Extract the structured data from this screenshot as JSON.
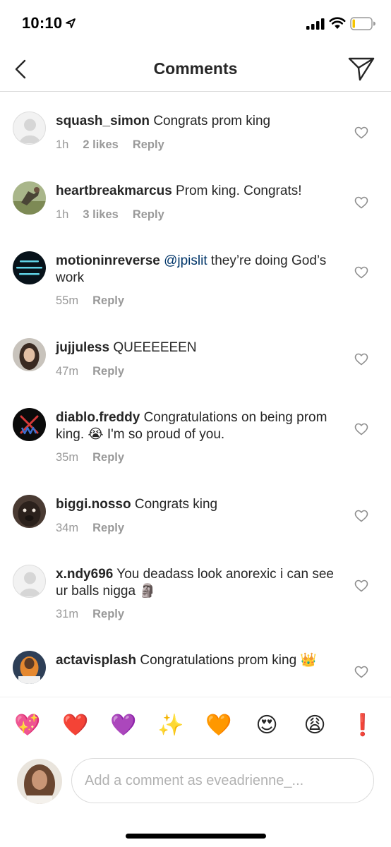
{
  "status_bar": {
    "time": "10:10"
  },
  "header": {
    "title": "Comments"
  },
  "comments": [
    {
      "username": "squash_simon",
      "mention": "",
      "text": "Congrats prom king",
      "time": "1h",
      "likes": "2 likes",
      "reply": "Reply"
    },
    {
      "username": "heartbreakmarcus",
      "mention": "",
      "text": "Prom king. Congrats!",
      "time": "1h",
      "likes": "3 likes",
      "reply": "Reply"
    },
    {
      "username": "motioninreverse",
      "mention": "@jpislit",
      "text": "they’re doing God’s work",
      "time": "55m",
      "likes": "",
      "reply": "Reply"
    },
    {
      "username": "jujjuless",
      "mention": "",
      "text": "QUEEEEEEN",
      "time": "47m",
      "likes": "",
      "reply": "Reply"
    },
    {
      "username": "diablo.freddy",
      "mention": "",
      "text": "Congratulations on being prom king. 😭 I'm so proud of you.",
      "time": "35m",
      "likes": "",
      "reply": "Reply"
    },
    {
      "username": "biggi.nosso",
      "mention": "",
      "text": "Congrats king",
      "time": "34m",
      "likes": "",
      "reply": "Reply"
    },
    {
      "username": "x.ndy696",
      "mention": "",
      "text": "You deadass look anorexic i can see ur balls nigga 🗿",
      "time": "31m",
      "likes": "",
      "reply": "Reply"
    },
    {
      "username": "actavisplash",
      "mention": "",
      "text": "Congratulations prom king 👑",
      "time": "",
      "likes": "",
      "reply": ""
    }
  ],
  "quick_emojis": [
    "💖",
    "❤️",
    "💜",
    "✨",
    "🧡",
    "😍",
    "😩",
    "❗"
  ],
  "composer": {
    "placeholder": "Add a comment as eveadrienne_..."
  },
  "colors": {
    "mention": "#003569",
    "meta": "#999999",
    "text": "#262626",
    "divider": "#dbdbdb"
  }
}
